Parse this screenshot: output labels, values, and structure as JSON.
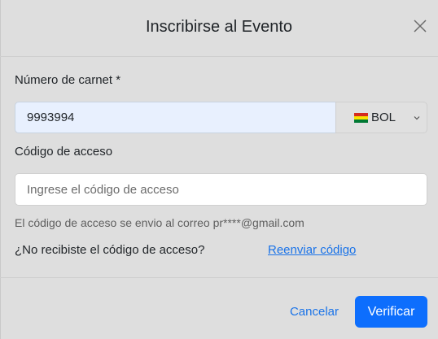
{
  "dialog": {
    "title": "Inscribirse al Evento"
  },
  "form": {
    "carnet": {
      "label": "Número de carnet *",
      "value": "9993994"
    },
    "country": {
      "selected": "BOL",
      "flag_colors": [
        "#d52b1e",
        "#f9e300",
        "#007934"
      ]
    },
    "code": {
      "label": "Código de acceso",
      "placeholder": "Ingrese el código de acceso",
      "value": ""
    },
    "help_text": "El código de acceso se envio al correo pr****@gmail.com",
    "resend_question": "¿No recibiste el código de acceso?",
    "resend_link": "Reenviar código"
  },
  "footer": {
    "cancel_label": "Cancelar",
    "verify_label": "Verificar"
  },
  "colors": {
    "accent": "#0d6efd",
    "link": "#1a73e8"
  },
  "icons": {
    "close": "close-icon",
    "chevron": "chevron-down-icon",
    "flag": "bolivia-flag-icon"
  }
}
